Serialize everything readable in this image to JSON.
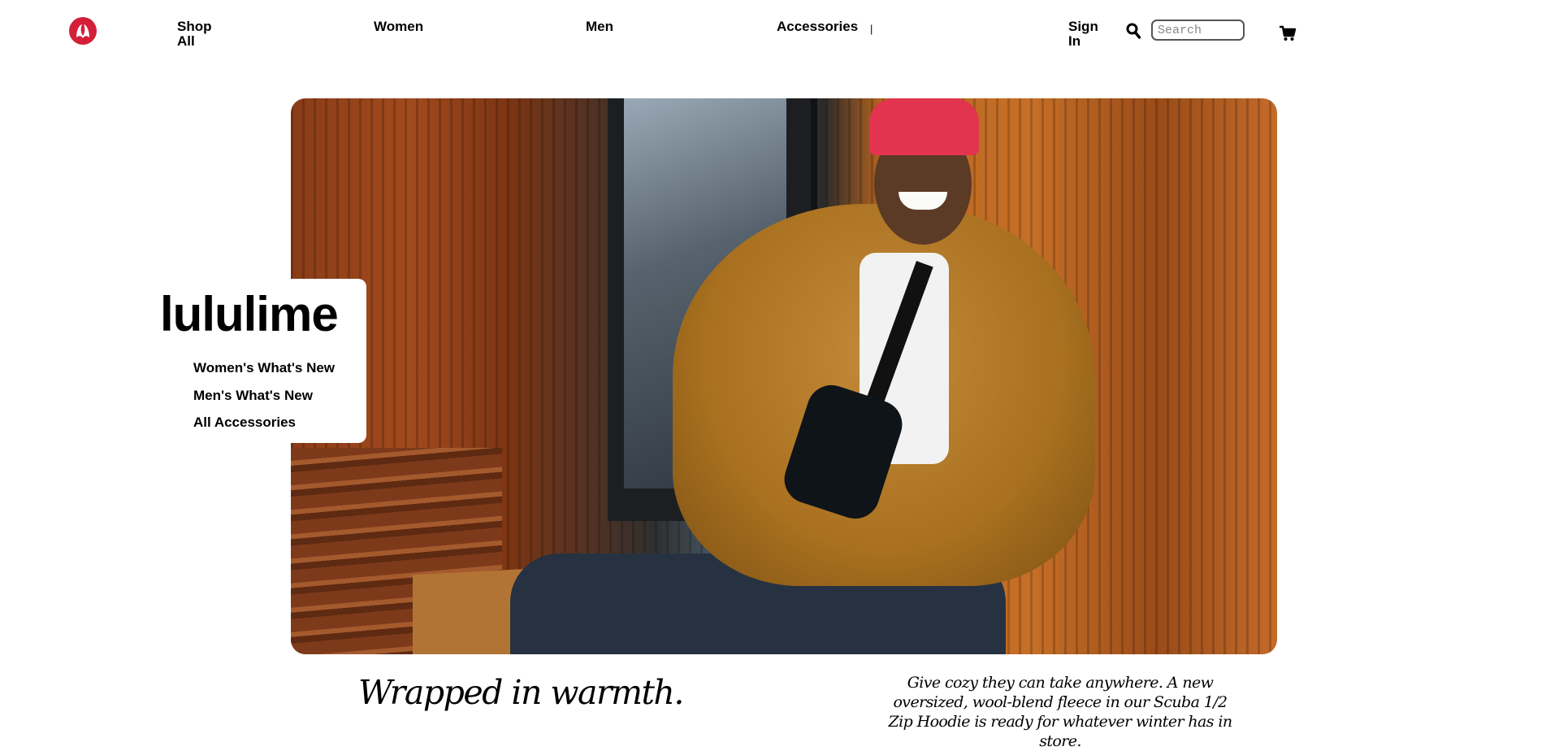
{
  "header": {
    "nav": [
      {
        "label": "Shop All"
      },
      {
        "label": "Women"
      },
      {
        "label": "Men"
      },
      {
        "label": "Accessories"
      }
    ],
    "separator": "|",
    "sign_in": "Sign In",
    "search": {
      "placeholder": "Search",
      "value": ""
    },
    "icons": {
      "logo": "lululemon-logo",
      "search": "magnifier-icon",
      "cart": "shopping-cart-icon"
    },
    "logo_color": "#d31f37"
  },
  "hero": {
    "brand": "lululime",
    "links": [
      {
        "label": "Women's What's New"
      },
      {
        "label": "Men's What's New"
      },
      {
        "label": "All Accessories"
      }
    ]
  },
  "promo": {
    "headline": "Wrapped in warmth.",
    "body": "Give cozy they can take anywhere. A new oversized, wool-blend fleece in our Scuba 1/2 Zip Hoodie is ready for whatever winter has in store."
  }
}
